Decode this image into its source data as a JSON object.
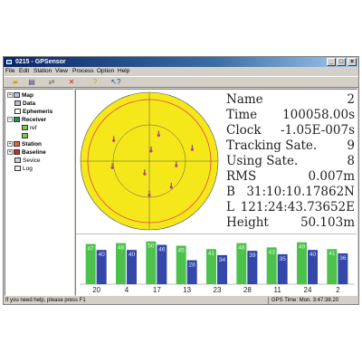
{
  "window": {
    "title": "0215 - GPSensor",
    "buttons": {
      "minimize": "_",
      "maximize": "□",
      "close": "×"
    }
  },
  "menu": [
    "File",
    "Edit",
    "Station",
    "View",
    "Process",
    "Option",
    "Help"
  ],
  "toolbar": [
    "open-icon",
    "save-icon",
    "connect-icon",
    "disconnect-icon",
    "help-icon",
    "context-help-icon"
  ],
  "tree": {
    "map": "Map",
    "data": "Data",
    "ephemeris": "Ephemeris",
    "receiver": "Receiver",
    "ref": "ref",
    "ref2": "",
    "station": "Station",
    "baseline": "Baseline",
    "service": "Sevice",
    "log": "Log"
  },
  "info": [
    {
      "label": "Name",
      "value": "2"
    },
    {
      "label": "Time",
      "value": "100058.00s"
    },
    {
      "label": "Clock",
      "value": "-1.05E-007s"
    },
    {
      "label": "Tracking Sate.",
      "value": "9"
    },
    {
      "label": "Using Sate.",
      "value": "8"
    },
    {
      "label": "RMS",
      "value": "0.007m"
    },
    {
      "label": "B",
      "value": "31:10:10.17862N"
    },
    {
      "label": "L",
      "value": "121:24:43.73652E"
    },
    {
      "label": "Height",
      "value": "50.103m"
    }
  ],
  "colors": {
    "sky_fill": "#f5e81a",
    "sky_ring": "#e8404a",
    "bar_green": "#4cc24c",
    "bar_blue": "#3348a8"
  },
  "chart_data": {
    "type": "bar",
    "categories": [
      "20",
      "4",
      "17",
      "13",
      "23",
      "28",
      "11",
      "24",
      "2"
    ],
    "series": [
      {
        "values": [
          47,
          48,
          50,
          45,
          41,
          48,
          43,
          49,
          41
        ]
      },
      {
        "values": [
          40,
          40,
          46,
          28,
          34,
          39,
          35,
          40,
          36
        ]
      }
    ],
    "ylim": [
      0,
      55
    ]
  },
  "satellites": [
    {
      "azimuth": 20,
      "elevation": 50
    },
    {
      "azimuth": 75,
      "elevation": 25
    },
    {
      "azimuth": 100,
      "elevation": 50
    },
    {
      "azimuth": 140,
      "elevation": 40
    },
    {
      "azimuth": 180,
      "elevation": 40
    },
    {
      "azimuth": 200,
      "elevation": 70
    },
    {
      "azimuth": 260,
      "elevation": 35
    },
    {
      "azimuth": 300,
      "elevation": 30
    },
    {
      "azimuth": 10,
      "elevation": 75
    }
  ],
  "status": {
    "left": "If you need help, please press F1",
    "right": "GPS Time: Mon.    3:47:38.20"
  }
}
